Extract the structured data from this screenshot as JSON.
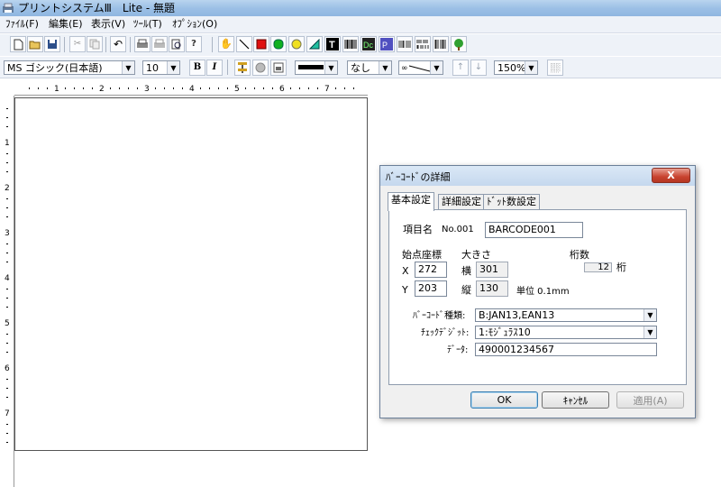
{
  "window": {
    "title": "プリントシステムⅢ　Lite - 無題"
  },
  "menu": [
    "ﾌｧｲﾙ(F)",
    "編集(E)",
    "表示(V)",
    "ﾂｰﾙ(T)",
    "ｵﾌﾟｼｮﾝ(O)"
  ],
  "toolbar2": {
    "font_name": "MS ゴシック(日本語)",
    "font_size": "10",
    "bold": "B",
    "italic": "I",
    "line_style": "なし",
    "zoom": "150%"
  },
  "ruler": {
    "h_marks": [
      "1",
      "2",
      "3",
      "4",
      "5",
      "6",
      "7"
    ],
    "v_marks": [
      "1",
      "2",
      "3",
      "4",
      "5",
      "6",
      "7"
    ]
  },
  "dialog": {
    "title": "ﾊﾞｰｺｰﾄﾞの詳細",
    "close": "X",
    "tabs": [
      "基本設定",
      "詳細設定",
      "ﾄﾞｯﾄ数設定"
    ],
    "item_label": "項目名",
    "item_no": "No.001",
    "item_name": "BARCODE001",
    "origin_label": "始点座標",
    "x_label": "X",
    "x_value": "272",
    "y_label": "Y",
    "y_value": "203",
    "size_label": "大きさ",
    "width_label": "横",
    "width_value": "301",
    "height_label": "縦",
    "height_value": "130",
    "unit_label": "単位 0.1mm",
    "digits_label": "桁数",
    "digits_value": "12",
    "digits_unit": "桁",
    "barcode_type_label": "ﾊﾞｰｺｰﾄﾞ種類:",
    "barcode_type_value": "B:JAN13,EAN13",
    "check_digit_label": "ﾁｪｯｸﾃﾞｼﾞｯﾄ:",
    "check_digit_value": "1:ﾓｼﾞｭﾗｽ10",
    "data_label": "ﾃﾞｰﾀ:",
    "data_value": "490001234567",
    "ok": "OK",
    "cancel": "ｷｬﾝｾﾙ",
    "apply": "適用(A)"
  }
}
